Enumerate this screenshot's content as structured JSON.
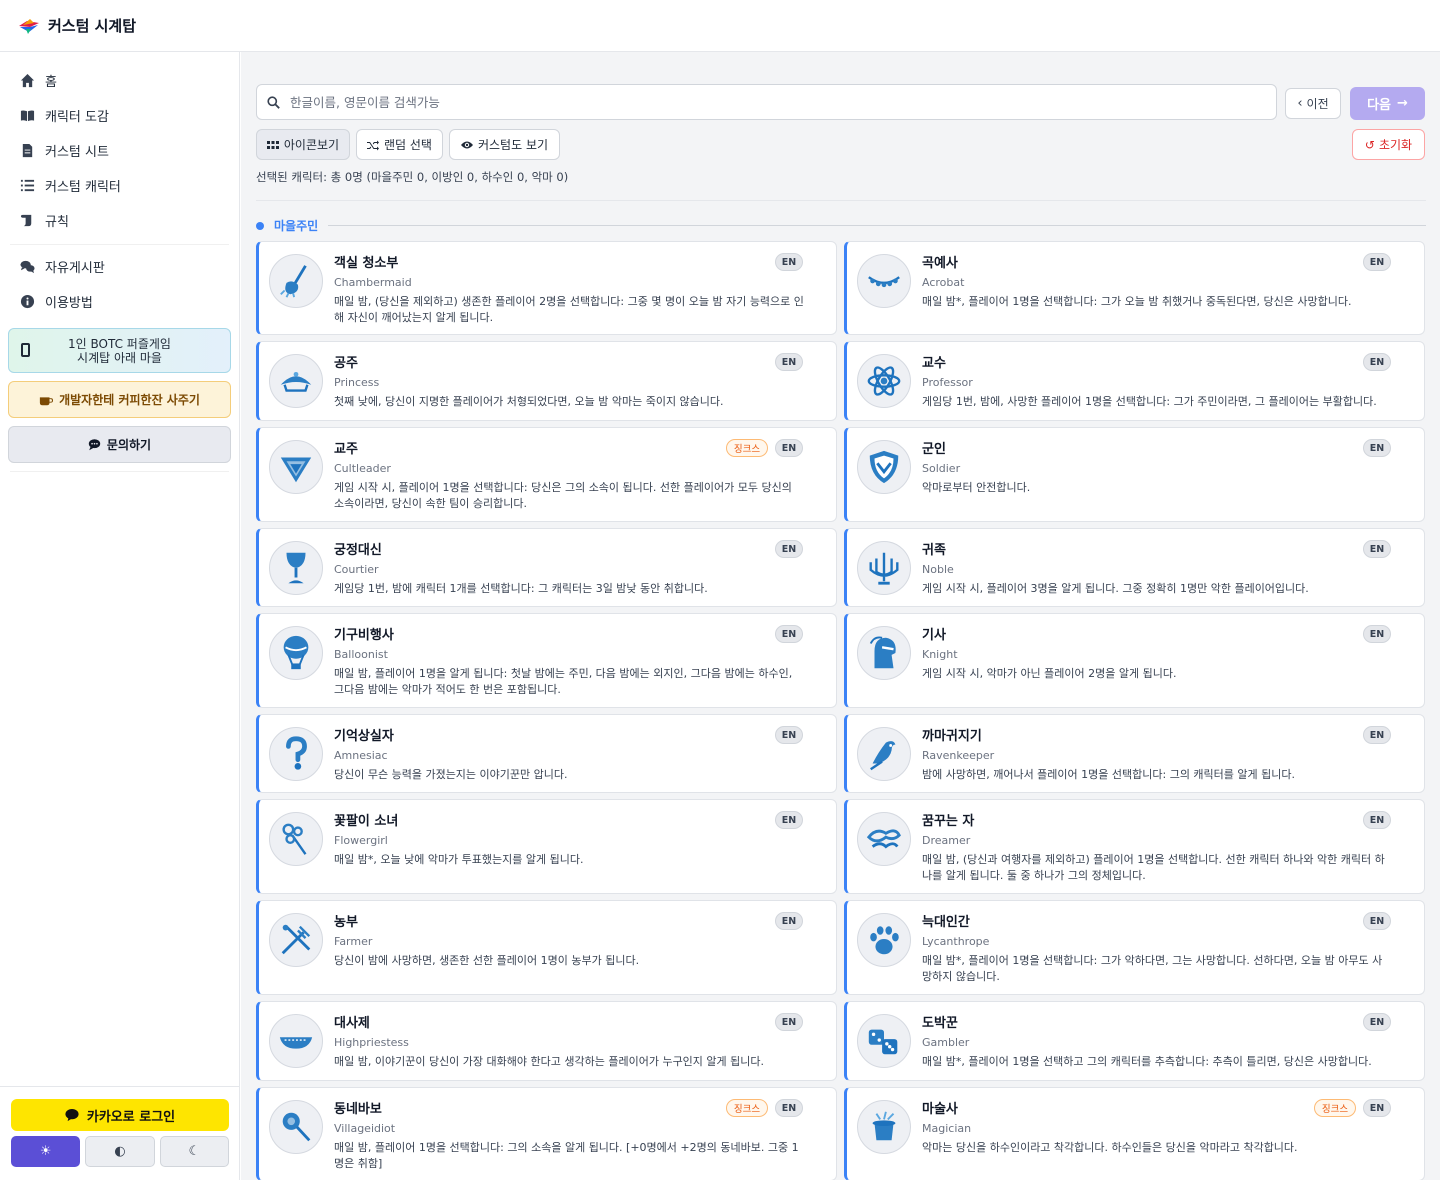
{
  "app": {
    "title": "커스텀 시계탑"
  },
  "sidebar": {
    "items": [
      {
        "label": "홈",
        "icon": "home-icon"
      },
      {
        "label": "캐릭터 도감",
        "icon": "book-icon"
      },
      {
        "label": "커스텀 시트",
        "icon": "document-icon"
      },
      {
        "label": "커스텀 캐릭터",
        "icon": "list-icon"
      },
      {
        "label": "규칙",
        "icon": "scroll-icon"
      }
    ],
    "items2": [
      {
        "label": "자유게시판",
        "icon": "comments-icon"
      },
      {
        "label": "이용방법",
        "icon": "info-icon"
      }
    ],
    "botc_line1": "1인 BOTC 퍼즐게임",
    "botc_line2": "시계탑 아래 마을",
    "coffee_label": "개발자한테 커피한잔 사주기",
    "ask_label": "문의하기",
    "kakao_label": "카카오로 로그인",
    "theme_light": "☀",
    "theme_auto": "◐",
    "theme_dark": "☾"
  },
  "toolbar": {
    "search_placeholder": "한글이름, 영문이름 검색가능",
    "prev_label": "이전",
    "next_label": "다음",
    "icon_view_label": "아이콘보기",
    "random_label": "랜덤 선택",
    "custom_view_label": "커스텀도 보기",
    "reset_label": "초기화",
    "selected_summary": "선택된 캐릭터: 총 0명 (마을주민 0, 이방인 0, 하수인 0, 악마 0)"
  },
  "colors": {
    "accent": "#3b82f6",
    "primary": "#5b4fd6",
    "next_disabled": "#b4aaf0",
    "kakao": "#fee500"
  },
  "section": {
    "label": "마을주민"
  },
  "characters": [
    {
      "name": "객실 청소부",
      "en": "Chambermaid",
      "desc": "매일 밤, (당신을 제외하고) 생존한 플레이어 2명을 선택합니다: 그중 몇 명이 오늘 밤 자기 능력으로 인해 자신이 깨어났는지 알게 됩니다.",
      "jinx": "",
      "badge": "EN",
      "icon": "mop-icon"
    },
    {
      "name": "곡예사",
      "en": "Acrobat",
      "desc": "매일 밤*, 플레이어 1명을 선택합니다: 그가 오늘 밤 취했거나 중독된다면, 당신은 사망합니다.",
      "jinx": "",
      "badge": "EN",
      "icon": "tightrope-icon"
    },
    {
      "name": "공주",
      "en": "Princess",
      "desc": "첫째 낮에, 당신이 지명한 플레이어가 처형되었다면, 오늘 밤 악마는 죽이지 않습니다.",
      "jinx": "",
      "badge": "EN",
      "icon": "tiara-icon"
    },
    {
      "name": "교수",
      "en": "Professor",
      "desc": "게임당 1번, 밤에, 사망한 플레이어 1명을 선택합니다: 그가 주민이라면, 그 플레이어는 부활합니다.",
      "jinx": "",
      "badge": "EN",
      "icon": "atom-icon"
    },
    {
      "name": "교주",
      "en": "Cultleader",
      "desc": "게임 시작 시, 플레이어 1명을 선택합니다: 당신은 그의 소속이 됩니다. 선한 플레이어가 모두 당신의 소속이라면, 당신이 속한 팀이 승리합니다.",
      "jinx": "징크스",
      "badge": "EN",
      "icon": "cult-symbol-icon"
    },
    {
      "name": "군인",
      "en": "Soldier",
      "desc": "악마로부터 안전합니다.",
      "jinx": "",
      "badge": "EN",
      "icon": "shield-icon"
    },
    {
      "name": "궁정대신",
      "en": "Courtier",
      "desc": "게임당 1번, 밤에 캐릭터 1개를 선택합니다: 그 캐릭터는 3일 밤낮 동안 취합니다.",
      "jinx": "",
      "badge": "EN",
      "icon": "goblet-icon"
    },
    {
      "name": "귀족",
      "en": "Noble",
      "desc": "게임 시작 시, 플레이어 3명을 알게 됩니다. 그중 정확히 1명만 악한 플레이어입니다.",
      "jinx": "",
      "badge": "EN",
      "icon": "candelabra-icon"
    },
    {
      "name": "기구비행사",
      "en": "Balloonist",
      "desc": "매일 밤, 플레이어 1명을 알게 됩니다: 첫날 밤에는 주민, 다음 밤에는 외지인, 그다음 밤에는 하수인, 그다음 밤에는 악마가 적어도 한 번은 포함됩니다.",
      "jinx": "",
      "badge": "EN",
      "icon": "balloon-icon"
    },
    {
      "name": "기사",
      "en": "Knight",
      "desc": "게임 시작 시, 악마가 아닌 플레이어 2명을 알게 됩니다.",
      "jinx": "",
      "badge": "EN",
      "icon": "knight-helmet-icon"
    },
    {
      "name": "기억상실자",
      "en": "Amnesiac",
      "desc": "당신이 무슨 능력을 가졌는지는 이야기꾼만 압니다.",
      "jinx": "",
      "badge": "EN",
      "icon": "question-mark-icon"
    },
    {
      "name": "까마귀지기",
      "en": "Ravenkeeper",
      "desc": "밤에 사망하면, 깨어나서 플레이어 1명을 선택합니다: 그의 캐릭터를 알게 됩니다.",
      "jinx": "",
      "badge": "EN",
      "icon": "raven-icon"
    },
    {
      "name": "꽃팔이 소녀",
      "en": "Flowergirl",
      "desc": "매일 밤*, 오늘 낮에 악마가 투표했는지를 알게 됩니다.",
      "jinx": "",
      "badge": "EN",
      "icon": "flower-icon"
    },
    {
      "name": "꿈꾸는 자",
      "en": "Dreamer",
      "desc": "매일 밤, (당신과 여행자를 제외하고) 플레이어 1명을 선택합니다. 선한 캐릭터 하나와 악한 캐릭터 하나를 알게 됩니다. 둘 중 하나가 그의 정체입니다.",
      "jinx": "",
      "badge": "EN",
      "icon": "dream-icon"
    },
    {
      "name": "농부",
      "en": "Farmer",
      "desc": "당신이 밤에 사망하면, 생존한 선한 플레이어 1명이 농부가 됩니다.",
      "jinx": "",
      "badge": "EN",
      "icon": "pitchfork-icon"
    },
    {
      "name": "늑대인간",
      "en": "Lycanthrope",
      "desc": "매일 밤*, 플레이어 1명을 선택합니다: 그가 악하다면, 그는 사망합니다. 선하다면, 오늘 밤 아무도 사망하지 않습니다.",
      "jinx": "",
      "badge": "EN",
      "icon": "paw-icon"
    },
    {
      "name": "대사제",
      "en": "Highpriestess",
      "desc": "매일 밤, 이야기꾼이 당신이 가장 대화해야 한다고 생각하는 플레이어가 누구인지 알게 됩니다.",
      "jinx": "",
      "badge": "EN",
      "icon": "bowl-icon"
    },
    {
      "name": "도박꾼",
      "en": "Gambler",
      "desc": "매일 밤*, 플레이어 1명을 선택하고 그의 캐릭터를 추측합니다: 추측이 틀리면, 당신은 사망합니다.",
      "jinx": "",
      "badge": "EN",
      "icon": "dice-icon"
    },
    {
      "name": "동네바보",
      "en": "Villageidiot",
      "desc": "매일 밤, 플레이어 1명을 선택합니다: 그의 소속을 알게 됩니다. [+0명에서 +2명의 동네바보. 그중 1명은 취함]",
      "jinx": "징크스",
      "badge": "EN",
      "icon": "rattle-icon"
    },
    {
      "name": "마술사",
      "en": "Magician",
      "desc": "악마는 당신을 하수인이라고 착각합니다. 하수인들은 당신을 악마라고 착각합니다.",
      "jinx": "징크스",
      "badge": "EN",
      "icon": "magic-hat-icon"
    }
  ]
}
